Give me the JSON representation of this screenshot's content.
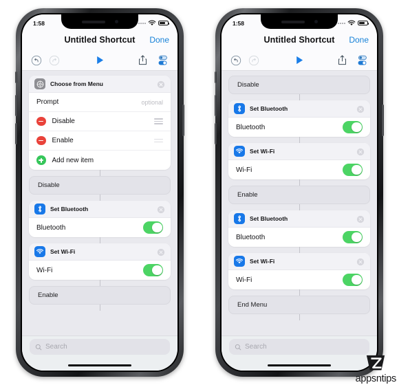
{
  "meta": {
    "watermark": "appsntips",
    "accent_blue": "#1782d8",
    "icon_blue": "#1878e8",
    "toggle_green": "#4cd464",
    "minus_red": "#e9423a",
    "plus_green": "#36c65a",
    "band_gray": "#e3e3e9",
    "screen_bg": "#e9e9ee"
  },
  "status_bar": {
    "time": "1:58",
    "wifi_icon": "wifi-icon",
    "battery_icon": "battery-icon"
  },
  "nav": {
    "title": "Untitled Shortcut",
    "done_label": "Done"
  },
  "toolbar": {
    "undo_icon": "undo-icon",
    "redo_icon": "redo-icon",
    "play_icon": "play-icon",
    "share_icon": "share-icon",
    "settings_icon": "settings-toggles-icon"
  },
  "search": {
    "placeholder": "Search",
    "icon": "search-icon"
  },
  "left_screen": {
    "menu_card": {
      "icon": "gear-icon",
      "title": "Choose from Menu",
      "close_icon": "close-icon",
      "prompt_label": "Prompt",
      "prompt_placeholder": "optional",
      "items": [
        {
          "label": "Disable",
          "badge": "minus",
          "grip": "full"
        },
        {
          "label": "Enable",
          "badge": "minus",
          "grip": "short"
        }
      ],
      "add_item_label": "Add new item",
      "add_item_badge": "plus"
    },
    "blocks": [
      {
        "kind": "band",
        "label": "Disable"
      },
      {
        "kind": "action",
        "icon": "bluetooth-icon",
        "title": "Set Bluetooth",
        "row_label": "Bluetooth",
        "toggle": "on"
      },
      {
        "kind": "action",
        "icon": "wifi-icon",
        "title": "Set Wi-Fi",
        "row_label": "Wi-Fi",
        "toggle": "on"
      },
      {
        "kind": "band",
        "label": "Enable"
      }
    ]
  },
  "right_screen": {
    "blocks": [
      {
        "kind": "band",
        "label": "Disable"
      },
      {
        "kind": "action",
        "icon": "bluetooth-icon",
        "title": "Set Bluetooth",
        "row_label": "Bluetooth",
        "toggle": "on"
      },
      {
        "kind": "action",
        "icon": "wifi-icon",
        "title": "Set Wi-Fi",
        "row_label": "Wi-Fi",
        "toggle": "on"
      },
      {
        "kind": "band",
        "label": "Enable"
      },
      {
        "kind": "action",
        "icon": "bluetooth-icon",
        "title": "Set Bluetooth",
        "row_label": "Bluetooth",
        "toggle": "on"
      },
      {
        "kind": "action",
        "icon": "wifi-icon",
        "title": "Set Wi-Fi",
        "row_label": "Wi-Fi",
        "toggle": "on"
      },
      {
        "kind": "band",
        "label": "End Menu"
      }
    ]
  }
}
